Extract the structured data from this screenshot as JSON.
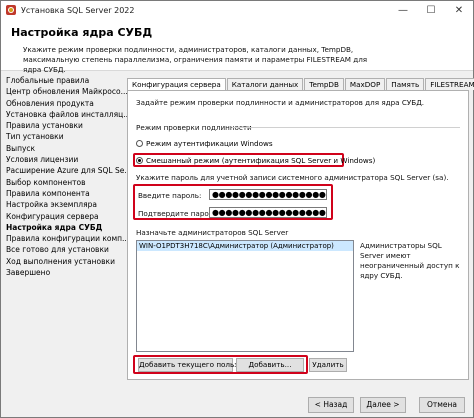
{
  "window": {
    "title": "Установка SQL Server 2022",
    "minimize": "—",
    "maximize": "☐",
    "close": "✕"
  },
  "header": {
    "title": "Настройка ядра СУБД",
    "description": "Укажите режим проверки подлинности, администраторов, каталоги данных, TempDB, максимальную степень параллелизма, ограничения памяти и параметры FILESTREAM для ядра СУБД."
  },
  "nav": {
    "items": [
      "Глобальные правила",
      "Центр обновления Майкросо...",
      "Обновления продукта",
      "Установка файлов инсталляц...",
      "Правила установки",
      "Тип установки",
      "Выпуск",
      "Условия лицензии",
      "Расширение Azure для SQL Se...",
      "Выбор компонентов",
      "Правила компонента",
      "Настройка экземпляра",
      "Конфигурация сервера",
      "Настройка ядра СУБД",
      "Правила конфигурации комп...",
      "Все готово для установки",
      "Ход выполнения установки",
      "Завершено"
    ],
    "active_index": 13
  },
  "tabs": [
    "Конфигурация сервера",
    "Каталоги данных",
    "TempDB",
    "MaxDOP",
    "Память",
    "FILESTREAM"
  ],
  "panel": {
    "intro": "Задайте режим проверки подлинности и администраторов для ядра СУБД.",
    "auth_group": "Режим проверки подлинности",
    "radio_windows": "Режим аутентификации Windows",
    "radio_mixed": "Смешанный режим (аутентификация SQL Server и Windows)",
    "sa_intro": "Укажите пароль для учетной записи системного администратора SQL Server (sa).",
    "password_label": "Введите пароль:",
    "password_value": "●●●●●●●●●●●●●●●●●●●●●●●●●●●",
    "confirm_label": "Подтвердите пароль:",
    "confirm_value": "●●●●●●●●●●●●●●●●●●●●●●●●●●●",
    "admins_label": "Назначьте администраторов SQL Server",
    "admins": [
      "WIN-O1PDT3H718C\\Администратор (Администратор)"
    ],
    "admins_note": "Администраторы SQL Server имеют неограниченный доступ к ядру СУБД.",
    "add_current_user": "Добавить текущего пользователя",
    "add": "Добавить...",
    "remove": "Удалить"
  },
  "footer": {
    "back": "< Назад",
    "next": "Далее >",
    "cancel": "Отмена"
  },
  "colors": {
    "highlight_red": "#d0021b",
    "selection": "#cce8ff"
  }
}
